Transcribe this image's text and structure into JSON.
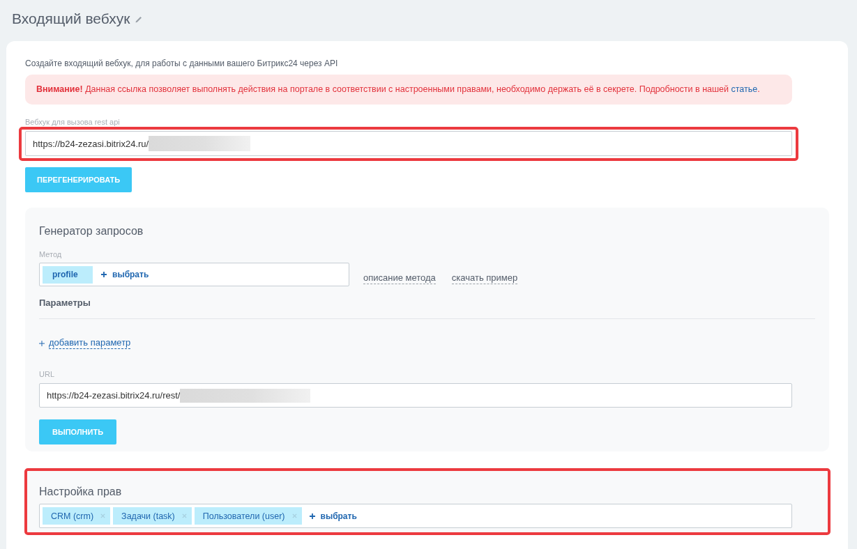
{
  "page": {
    "title": "Входящий вебхук"
  },
  "intro": "Создайте входящий вебхук, для работы с данными вашего Битрикс24 через API",
  "alert": {
    "text": "**Внимание!** Данная ссылка позволяет выполнять действия на портале в соответствии с настроенными правами, необходимо держать её в секрете. Подробности в нашей",
    "link": "статье",
    "end": "."
  },
  "webhook_field": {
    "label": "Вебхук для вызова rest api",
    "value": "https://b24-zezasi.bitrix24.ru/",
    "redacted": true,
    "highlighted": true
  },
  "regenerate_button": "ПЕРЕГЕНЕРИРОВАТЬ",
  "generator": {
    "title": "Генератор запросов",
    "method_label": "Метод",
    "method_tags": [
      {
        "label": "profile",
        "removable": false
      }
    ],
    "select_label": "выбрать",
    "links": [
      "описание метода",
      "скачать пример"
    ],
    "params_title": "Параметры",
    "add_param": "добавить параметр",
    "url_field": {
      "label": "URL",
      "value": "https://b24-zezasi.bitrix24.ru/rest/",
      "redacted": true
    },
    "run_button": "ВЫПОЛНИТЬ"
  },
  "rights": {
    "title": "Настройка прав",
    "highlighted": true,
    "tags": [
      {
        "label": "CRM (crm)",
        "removable": true
      },
      {
        "label": "Задачи (task)",
        "removable": true
      },
      {
        "label": "Пользователи (user)",
        "removable": true
      }
    ],
    "select_label": "выбрать"
  }
}
